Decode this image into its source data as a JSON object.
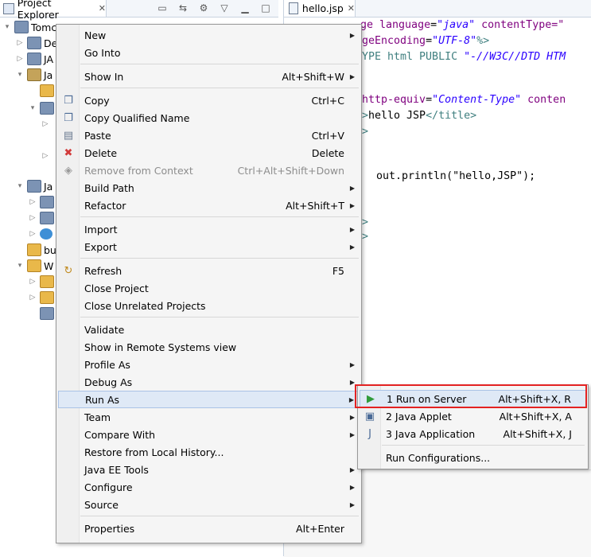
{
  "explorer": {
    "tab_label": "Project Explorer",
    "close_glyph": "✕",
    "tree": [
      {
        "label": "Tomc",
        "indent": 0,
        "twisty": "▾",
        "icon": "project"
      },
      {
        "label": "De",
        "indent": 1,
        "twisty": "▷",
        "icon": "jar"
      },
      {
        "label": "JA",
        "indent": 1,
        "twisty": "▷",
        "icon": "jar"
      },
      {
        "label": "Ja",
        "indent": 1,
        "twisty": "▾",
        "icon": "pkg"
      },
      {
        "label": "",
        "indent": 2,
        "twisty": "",
        "icon": "folder"
      },
      {
        "label": "",
        "indent": 2,
        "twisty": "▾",
        "icon": "jar"
      },
      {
        "label": "",
        "indent": 3,
        "twisty": "▷",
        "icon": ""
      },
      {
        "label": "",
        "indent": 3,
        "twisty": "",
        "icon": ""
      },
      {
        "label": "",
        "indent": 3,
        "twisty": "▷",
        "icon": ""
      },
      {
        "label": "",
        "indent": 3,
        "twisty": "",
        "icon": ""
      },
      {
        "label": "Ja",
        "indent": 1,
        "twisty": "▾",
        "icon": "jar"
      },
      {
        "label": "",
        "indent": 2,
        "twisty": "▷",
        "icon": "jar"
      },
      {
        "label": "",
        "indent": 2,
        "twisty": "▷",
        "icon": "jar"
      },
      {
        "label": "",
        "indent": 2,
        "twisty": "▷",
        "icon": "globe"
      },
      {
        "label": "bu",
        "indent": 1,
        "twisty": "",
        "icon": "folder"
      },
      {
        "label": "W",
        "indent": 1,
        "twisty": "▾",
        "icon": "folder"
      },
      {
        "label": "",
        "indent": 2,
        "twisty": "▷",
        "icon": "folder"
      },
      {
        "label": "",
        "indent": 2,
        "twisty": "▷",
        "icon": "folder"
      },
      {
        "label": "",
        "indent": 2,
        "twisty": "",
        "icon": "file"
      }
    ]
  },
  "editor": {
    "tab_label": "hello.jsp",
    "close_glyph": "✕",
    "code_lines": [
      {
        "parts": [
          {
            "t": "ge ",
            "c": "attr"
          },
          {
            "t": "language",
            "c": "attr"
          },
          {
            "t": "=",
            "c": "kw"
          },
          {
            "t": "\"java\"",
            "c": "str"
          },
          {
            "t": " contentType=\"",
            "c": "attr"
          }
        ]
      },
      {
        "parts": [
          {
            "t": "geEncoding",
            "c": "attr"
          },
          {
            "t": "=",
            "c": "kw"
          },
          {
            "t": "\"UTF-8\"",
            "c": "str"
          },
          {
            "t": "%>",
            "c": "tag"
          }
        ]
      },
      {
        "parts": [
          {
            "t": "YPE html PUBLIC ",
            "c": "tag"
          },
          {
            "t": "\"-//W3C//DTD HTM",
            "c": "str"
          }
        ]
      },
      {
        "parts": []
      },
      {
        "parts": [
          {
            "t": "http-equiv",
            "c": "attr"
          },
          {
            "t": "=",
            "c": "kw"
          },
          {
            "t": "\"Content-Type\"",
            "c": "str"
          },
          {
            "t": " conten",
            "c": "attr"
          }
        ]
      },
      {
        "parts": [
          {
            "t": ">",
            "c": "tag"
          },
          {
            "t": "hello JSP",
            "c": "kw"
          },
          {
            "t": "</title>",
            "c": "tag"
          }
        ]
      },
      {
        "parts": [
          {
            "t": ">",
            "c": "tag"
          }
        ]
      },
      {
        "parts": []
      },
      {
        "parts": []
      },
      {
        "parts": [
          {
            "t": "  out.println(\"hello,JSP\");",
            "c": "kw"
          }
        ]
      },
      {
        "parts": []
      },
      {
        "parts": [
          {
            "t": ">",
            "c": "tag"
          }
        ]
      },
      {
        "parts": [
          {
            "t": ">",
            "c": "tag"
          }
        ]
      }
    ]
  },
  "context_menu": {
    "items": [
      {
        "label": "New",
        "accel": "",
        "submenu": true,
        "icon": ""
      },
      {
        "label": "Go Into",
        "accel": "",
        "submenu": false,
        "icon": ""
      },
      {
        "sep": true
      },
      {
        "label": "Show In",
        "accel": "Alt+Shift+W",
        "submenu": true,
        "icon": ""
      },
      {
        "sep": true
      },
      {
        "label": "Copy",
        "accel": "Ctrl+C",
        "submenu": false,
        "icon": "copy-icon"
      },
      {
        "label": "Copy Qualified Name",
        "accel": "",
        "submenu": false,
        "icon": "copy-qualified-icon"
      },
      {
        "label": "Paste",
        "accel": "Ctrl+V",
        "submenu": false,
        "icon": "paste-icon"
      },
      {
        "label": "Delete",
        "accel": "Delete",
        "submenu": false,
        "icon": "delete-icon"
      },
      {
        "label": "Remove from Context",
        "accel": "Ctrl+Alt+Shift+Down",
        "submenu": false,
        "icon": "remove-context-icon",
        "disabled": true
      },
      {
        "label": "Build Path",
        "accel": "",
        "submenu": true,
        "icon": ""
      },
      {
        "label": "Refactor",
        "accel": "Alt+Shift+T",
        "submenu": true,
        "icon": ""
      },
      {
        "sep": true
      },
      {
        "label": "Import",
        "accel": "",
        "submenu": true,
        "icon": ""
      },
      {
        "label": "Export",
        "accel": "",
        "submenu": true,
        "icon": ""
      },
      {
        "sep": true
      },
      {
        "label": "Refresh",
        "accel": "F5",
        "submenu": false,
        "icon": "refresh-icon"
      },
      {
        "label": "Close Project",
        "accel": "",
        "submenu": false,
        "icon": ""
      },
      {
        "label": "Close Unrelated Projects",
        "accel": "",
        "submenu": false,
        "icon": ""
      },
      {
        "sep": true
      },
      {
        "label": "Validate",
        "accel": "",
        "submenu": false,
        "icon": ""
      },
      {
        "label": "Show in Remote Systems view",
        "accel": "",
        "submenu": false,
        "icon": ""
      },
      {
        "label": "Profile As",
        "accel": "",
        "submenu": true,
        "icon": ""
      },
      {
        "label": "Debug As",
        "accel": "",
        "submenu": true,
        "icon": ""
      },
      {
        "label": "Run As",
        "accel": "",
        "submenu": true,
        "icon": "",
        "highlight": true
      },
      {
        "label": "Team",
        "accel": "",
        "submenu": true,
        "icon": ""
      },
      {
        "label": "Compare With",
        "accel": "",
        "submenu": true,
        "icon": ""
      },
      {
        "label": "Restore from Local History...",
        "accel": "",
        "submenu": false,
        "icon": ""
      },
      {
        "label": "Java EE Tools",
        "accel": "",
        "submenu": true,
        "icon": ""
      },
      {
        "label": "Configure",
        "accel": "",
        "submenu": true,
        "icon": ""
      },
      {
        "label": "Source",
        "accel": "",
        "submenu": true,
        "icon": ""
      },
      {
        "sep": true
      },
      {
        "label": "Properties",
        "accel": "Alt+Enter",
        "submenu": false,
        "icon": ""
      }
    ]
  },
  "run_as_submenu": {
    "items": [
      {
        "label": "1 Run on Server",
        "accel": "Alt+Shift+X, R",
        "icon": "run-server-icon",
        "highlight": true
      },
      {
        "label": "2 Java Applet",
        "accel": "Alt+Shift+X, A",
        "icon": "java-applet-icon"
      },
      {
        "label": "3 Java Application",
        "accel": "Alt+Shift+X, J",
        "icon": "java-app-icon"
      },
      {
        "sep": true
      },
      {
        "label": "Run Configurations...",
        "accel": "",
        "icon": ""
      }
    ]
  },
  "colors": {
    "highlight_border": "#e32222",
    "menu_highlight_bg": "#dfe9f6"
  }
}
